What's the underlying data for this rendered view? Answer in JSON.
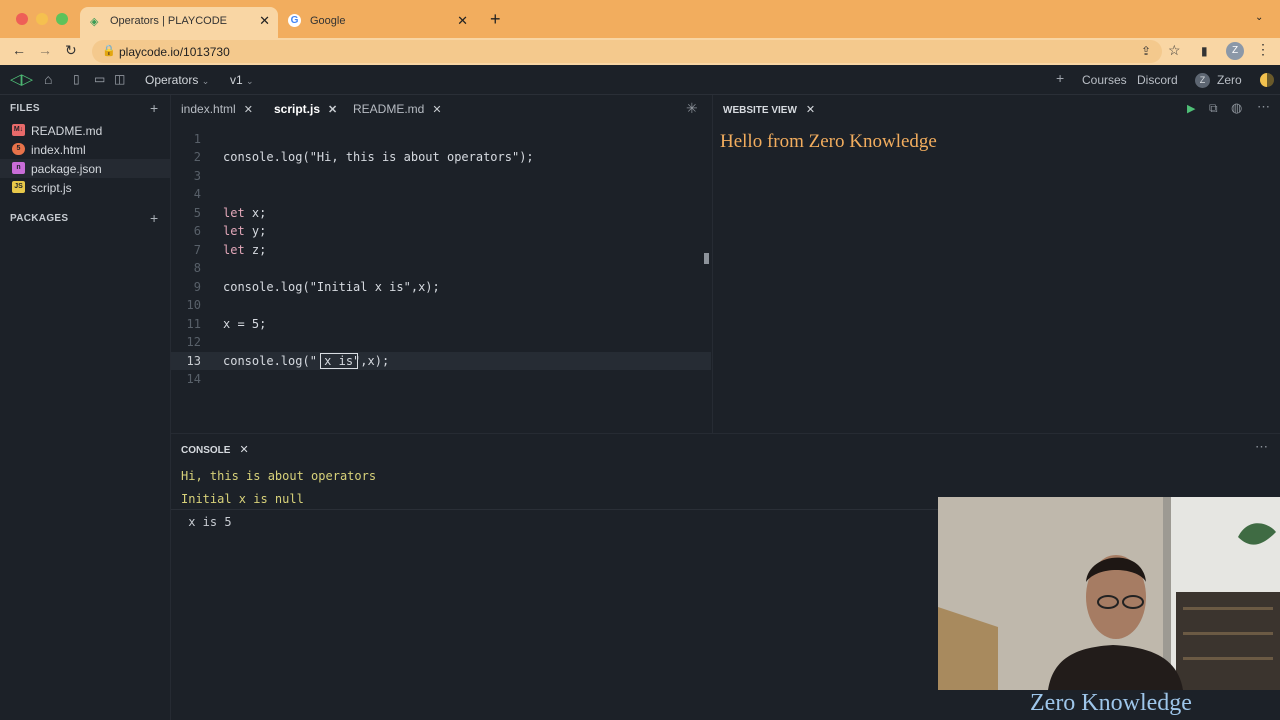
{
  "browser": {
    "tabs": [
      {
        "title": "Operators | PLAYCODE",
        "close": "✕"
      },
      {
        "title": "Google",
        "close": "✕"
      }
    ],
    "new_tab": "+",
    "url": "playcode.io/1013730",
    "colors": {
      "tabbar": "#f2ad5e",
      "addressbar": "#f9d6a4"
    }
  },
  "app": {
    "project_name": "Operators",
    "version": "v1",
    "nav_right": {
      "courses": "Courses",
      "discord": "Discord",
      "user": "Zero",
      "avatar_letter": "Z"
    }
  },
  "sidebar": {
    "files_label": "FILES",
    "packages_label": "PACKAGES",
    "files": [
      {
        "name": "README.md",
        "icon": "M↓",
        "icon_color": "#e86a6a"
      },
      {
        "name": "index.html",
        "icon": "5",
        "icon_color": "#e8734a"
      },
      {
        "name": "package.json",
        "icon": "n",
        "icon_color": "#c96dd8"
      },
      {
        "name": "script.js",
        "icon": "JS",
        "icon_color": "#e7c84a"
      }
    ]
  },
  "editor": {
    "tabs": [
      {
        "name": "index.html",
        "active": false
      },
      {
        "name": "script.js",
        "active": true
      },
      {
        "name": "README.md",
        "active": false
      }
    ],
    "lines": [
      {
        "n": "1",
        "pre": "",
        "kw": "",
        "rest": ""
      },
      {
        "n": "2",
        "pre": "console.log(\"Hi, this is about operators\");",
        "kw": "",
        "rest": ""
      },
      {
        "n": "3",
        "pre": "",
        "kw": "",
        "rest": ""
      },
      {
        "n": "4",
        "pre": "",
        "kw": "",
        "rest": ""
      },
      {
        "n": "5",
        "pre": "",
        "kw": "let",
        "rest": " x;"
      },
      {
        "n": "6",
        "pre": "",
        "kw": "let",
        "rest": " y;"
      },
      {
        "n": "7",
        "pre": "",
        "kw": "let",
        "rest": " z;"
      },
      {
        "n": "8",
        "pre": "",
        "kw": "",
        "rest": ""
      },
      {
        "n": "9",
        "pre": "console.log(\"Initial x is\",x);",
        "kw": "",
        "rest": ""
      },
      {
        "n": "10",
        "pre": "",
        "kw": "",
        "rest": ""
      },
      {
        "n": "11",
        "pre": "x = 5;",
        "kw": "",
        "rest": ""
      },
      {
        "n": "12",
        "pre": "",
        "kw": "",
        "rest": ""
      },
      {
        "n": "13",
        "pre": "console.log(\" x is\",x);",
        "kw": "",
        "rest": ""
      },
      {
        "n": "14",
        "pre": "",
        "kw": "",
        "rest": ""
      }
    ],
    "current_line": "13"
  },
  "website_view": {
    "label": "WEBSITE VIEW",
    "content": "Hello from Zero Knowledge"
  },
  "console": {
    "label": "CONSOLE",
    "lines": [
      {
        "text": "Hi, this is about operators",
        "color": "#d8d27a"
      },
      {
        "text": "Initial x is null",
        "color": "#d8d27a"
      },
      {
        "text": " x is 5",
        "color": "#c8ccd2"
      }
    ]
  },
  "watermark": "Zero Knowledge"
}
